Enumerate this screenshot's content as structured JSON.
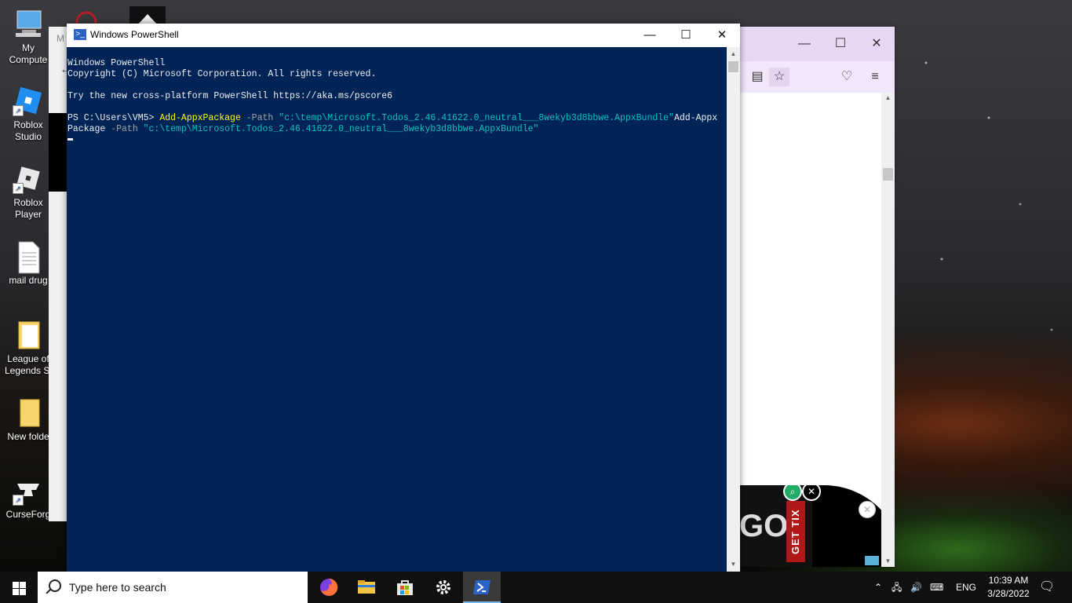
{
  "desktop": {
    "icons": [
      {
        "label": "My\nCompute"
      },
      {
        "label": "Roblox\nStudio"
      },
      {
        "label": "Roblox\nPlayer"
      },
      {
        "label": "mail drug"
      },
      {
        "label": "League of\nLegends Si"
      },
      {
        "label": "New folde"
      },
      {
        "label": "CurseForg"
      }
    ],
    "bg_window_letter": "M"
  },
  "powershell": {
    "title": "Windows PowerShell",
    "controls": {
      "minimize": "—",
      "maximize": "☐",
      "close": "✕"
    },
    "lines": {
      "l1": "Windows PowerShell",
      "l2": "Copyright (C) Microsoft Corporation. All rights reserved.",
      "l3": "Try the new cross-platform PowerShell https://aka.ms/pscore6",
      "prompt": "PS C:\\Users\\VM5> ",
      "cmd1": "Add-AppxPackage",
      "param1": " -Path ",
      "str1": "\"c:\\temp\\Microsoft.Todos_2.46.41622.0_neutral___8wekyb3d8bbwe.AppxBundle\"",
      "cont1": "Add-Appx",
      "cont2": "Package",
      "param2": " -Path ",
      "str2": "\"c:\\temp\\Microsoft.Todos_2.46.41622.0_neutral___8wekyb3d8bbwe.AppxBundle\""
    }
  },
  "browser": {
    "controls": {
      "minimize": "—",
      "maximize": "☐",
      "close": "✕"
    },
    "ad": {
      "cta": "GET TIX",
      "partial_text": "GO"
    }
  },
  "taskbar": {
    "search_placeholder": "Type here to search",
    "apps": [
      "firefox-icon",
      "file-explorer-icon",
      "microsoft-store-icon",
      "settings-icon",
      "powershell-icon"
    ],
    "tray": {
      "language": "ENG"
    },
    "clock": {
      "time": "10:39 AM",
      "date": "3/28/2022"
    }
  },
  "colors": {
    "console_bg": "#012456",
    "cmd": "#ffff00",
    "string": "#00c0c0",
    "param": "#a0a0a0"
  }
}
